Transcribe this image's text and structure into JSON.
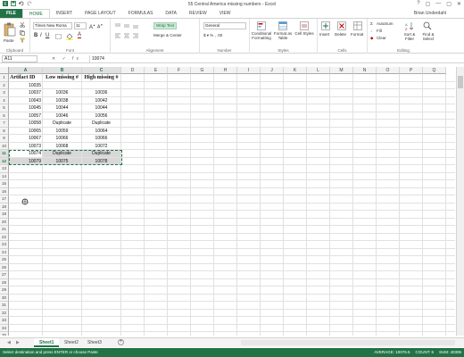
{
  "window": {
    "title": "55 Central America missing numbers - Excel",
    "user": "Brian Underdahl",
    "controls": [
      "?",
      "▢",
      "—",
      "▢",
      "✕"
    ]
  },
  "ribbon": {
    "tabs": [
      "FILE",
      "HOME",
      "INSERT",
      "PAGE LAYOUT",
      "FORMULAS",
      "DATA",
      "REVIEW",
      "VIEW"
    ],
    "active_tab": "HOME",
    "clipboard": {
      "label": "Clipboard",
      "paste": "Paste"
    },
    "font": {
      "label": "Font",
      "name": "Times New Roma",
      "size": "11"
    },
    "alignment": {
      "label": "Alignment",
      "wrap_text": "Wrap Text",
      "merge_center": "Merge & Center"
    },
    "number": {
      "label": "Number",
      "format": "General"
    },
    "styles": {
      "label": "Styles",
      "conditional": "Conditional Formatting",
      "format_as_table": "Format as Table",
      "cell_styles": "Cell Styles"
    },
    "cells": {
      "label": "Cells",
      "insert": "Insert",
      "delete": "Delete",
      "format": "Format"
    },
    "editing": {
      "label": "Editing",
      "autosum": "AutoSum",
      "fill": "Fill",
      "clear": "Clear",
      "sort_filter": "Sort & Filter",
      "find_select": "Find & Select"
    }
  },
  "formula_bar": {
    "name_box": "A11",
    "fx": "✕ ✓ fx",
    "value": "10074"
  },
  "columns": [
    "A",
    "B",
    "C",
    "D",
    "E",
    "F",
    "G",
    "H",
    "I",
    "J",
    "K",
    "L",
    "M",
    "N",
    "O",
    "P",
    "Q"
  ],
  "rows": [
    "1",
    "2",
    "3",
    "4",
    "5",
    "6",
    "7",
    "8",
    "9",
    "10",
    "11",
    "12",
    "13",
    "14",
    "15",
    "16",
    "17",
    "18",
    "19",
    "20",
    "21",
    "22",
    "23",
    "24",
    "25",
    "26",
    "27",
    "28",
    "29",
    "30",
    "31",
    "32",
    "33",
    "34",
    "35"
  ],
  "sheet": {
    "headers": [
      "Artifact ID",
      "Low missing #",
      "High missing #"
    ],
    "data": [
      [
        "10035",
        "",
        ""
      ],
      [
        "10037",
        "10036",
        "10036"
      ],
      [
        "10043",
        "10038",
        "10042"
      ],
      [
        "10045",
        "10044",
        "10044"
      ],
      [
        "10057",
        "10046",
        "10056"
      ],
      [
        "10058",
        "Duplicate",
        "Duplicate"
      ],
      [
        "10065",
        "10059",
        "10064"
      ],
      [
        "10067",
        "10066",
        "10066"
      ],
      [
        "10073",
        "10068",
        "10072"
      ],
      [
        "10074",
        "Duplicate",
        "Duplicate"
      ],
      [
        "10079",
        "10075",
        "10078"
      ]
    ]
  },
  "sheet_tabs": [
    "Sheet1",
    "Sheet2",
    "Sheet3"
  ],
  "active_sheet": "Sheet1",
  "status": {
    "message": "Select destination and press ENTER or choose Paste",
    "average": "AVERAGE: 10076.5",
    "count": "COUNT: 6",
    "sum": "SUM: 40306"
  }
}
